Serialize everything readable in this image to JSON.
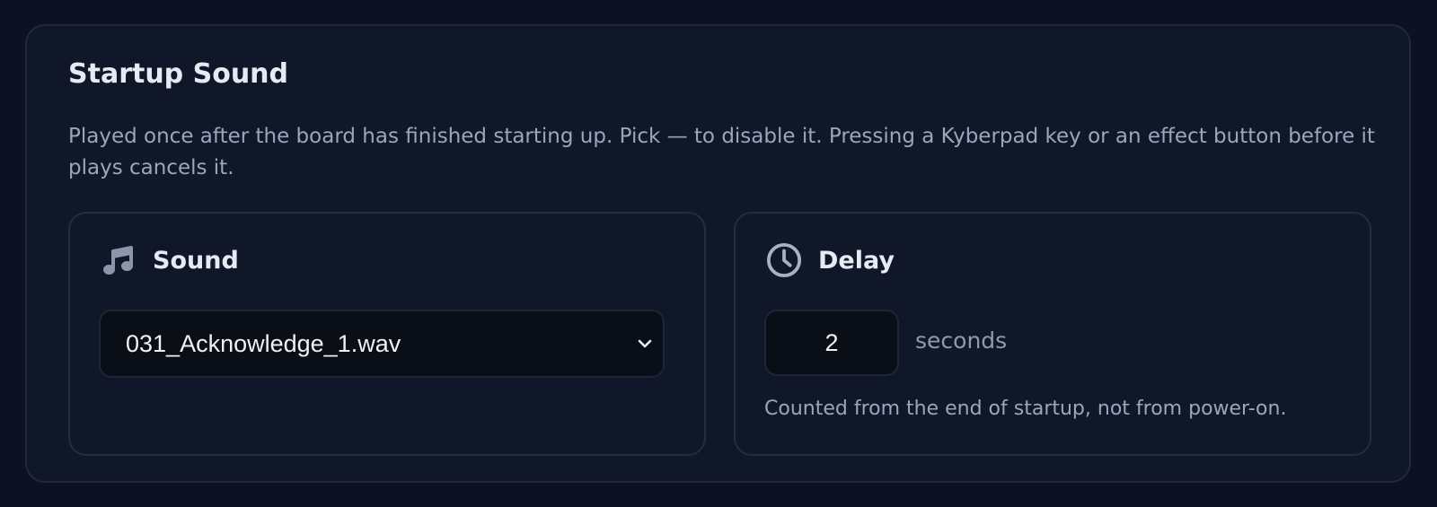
{
  "section": {
    "title": "Startup Sound",
    "description": "Played once after the board has finished starting up. Pick — to disable it. Pressing a Kyberpad key or an effect button before it plays cancels it."
  },
  "sound_card": {
    "icon": "music-note-icon",
    "label": "Sound",
    "selected_value": "031_Acknowledge_1.wav"
  },
  "delay_card": {
    "icon": "clock-icon",
    "label": "Delay",
    "value": "2",
    "unit": "seconds",
    "hint": "Counted from the end of startup, not from power-on."
  },
  "colors": {
    "page_bg": "#0c1222",
    "panel_bg": "#101729",
    "border": "#1f2a3e",
    "input_bg": "#0a0e16",
    "heading": "#e6ebf3",
    "muted_text": "#9aa6bb"
  }
}
